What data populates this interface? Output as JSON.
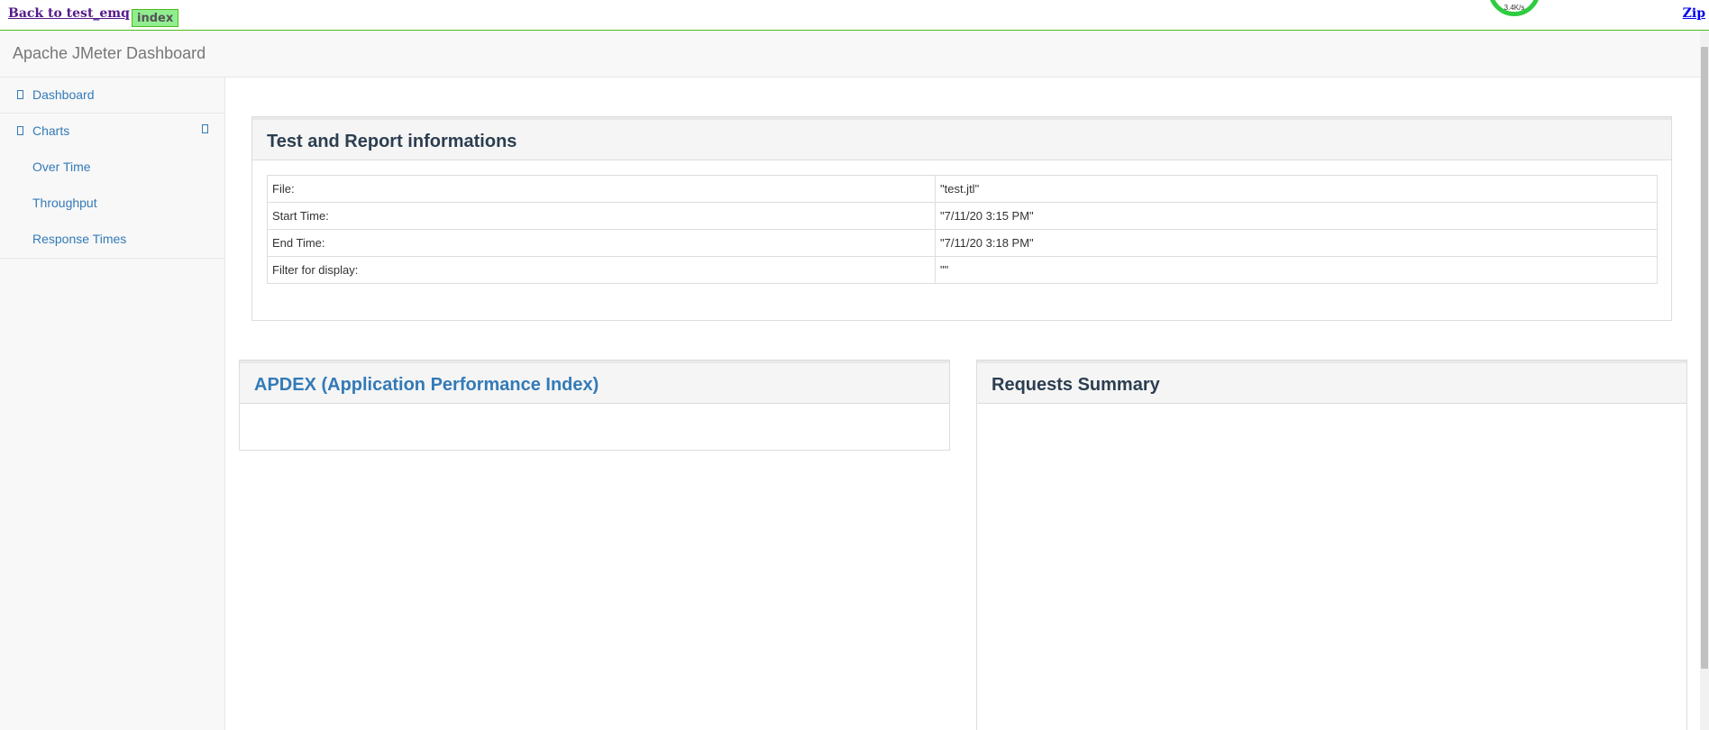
{
  "topbar": {
    "back_link": "Back to test_emq",
    "index_badge": "index",
    "zip_link": "Zip",
    "speed_indicator": "3.4K/s"
  },
  "navbar": {
    "brand": "Apache JMeter Dashboard"
  },
  "sidebar": {
    "dashboard": "Dashboard",
    "charts": "Charts",
    "chart_items": [
      "Over Time",
      "Throughput",
      "Response Times"
    ]
  },
  "info_panel": {
    "title": "Test and Report informations",
    "rows": [
      {
        "key": "File:",
        "value": "\"test.jtl\""
      },
      {
        "key": "Start Time:",
        "value": "\"7/11/20 3:15 PM\""
      },
      {
        "key": "End Time:",
        "value": "\"7/11/20 3:18 PM\""
      },
      {
        "key": "Filter for display:",
        "value": "\"\""
      }
    ]
  },
  "apdex_panel": {
    "title": "APDEX (Application Performance Index)"
  },
  "summary_panel": {
    "title": "Requests Summary"
  }
}
